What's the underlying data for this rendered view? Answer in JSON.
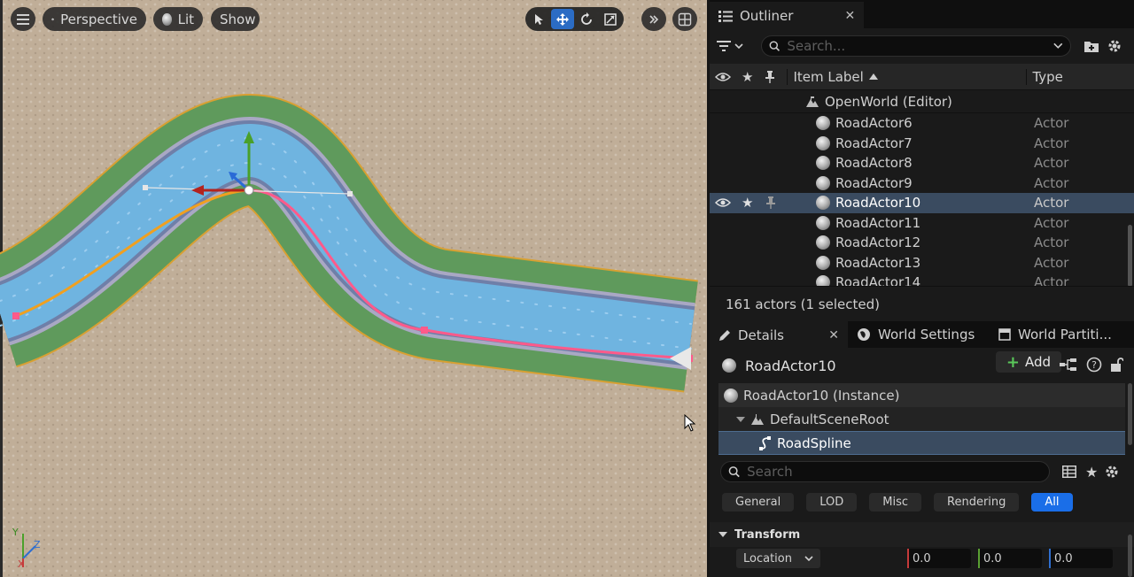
{
  "viewport": {
    "menu_icon": "hamburger-icon",
    "perspective_label": "Perspective",
    "lit_label": "Lit",
    "show_label": "Show",
    "tools": [
      "select-icon",
      "move-icon",
      "rotate-icon",
      "scale-icon"
    ],
    "active_tool": "move",
    "axis": {
      "x": "X",
      "y": "Y",
      "z": "Z"
    }
  },
  "outliner": {
    "tab_label": "Outliner",
    "search_placeholder": "Search...",
    "col_label": "Item Label",
    "col_type": "Type",
    "world_label": "OpenWorld (Editor)",
    "rows": [
      {
        "label": "RoadActor6",
        "type": "Actor",
        "selected": false
      },
      {
        "label": "RoadActor7",
        "type": "Actor",
        "selected": false
      },
      {
        "label": "RoadActor8",
        "type": "Actor",
        "selected": false
      },
      {
        "label": "RoadActor9",
        "type": "Actor",
        "selected": false
      },
      {
        "label": "RoadActor10",
        "type": "Actor",
        "selected": true
      },
      {
        "label": "RoadActor11",
        "type": "Actor",
        "selected": false
      },
      {
        "label": "RoadActor12",
        "type": "Actor",
        "selected": false
      },
      {
        "label": "RoadActor13",
        "type": "Actor",
        "selected": false
      },
      {
        "label": "RoadActor14",
        "type": "Actor",
        "selected": false
      }
    ],
    "status": "161 actors (1 selected)"
  },
  "details": {
    "tabs": [
      "Details",
      "World Settings",
      "World Partiti..."
    ],
    "actor_name": "RoadActor10",
    "add_label": "Add",
    "components": {
      "instance": "RoadActor10 (Instance)",
      "root": "DefaultSceneRoot",
      "spline": "RoadSpline"
    },
    "search_placeholder": "Search",
    "filters": [
      "General",
      "LOD",
      "Misc",
      "Rendering",
      "All"
    ],
    "active_filter": "All",
    "section": "Transform",
    "location_label": "Location",
    "location": {
      "x": "0.0",
      "y": "0.0",
      "z": "0.0"
    }
  },
  "colors": {
    "selection": "#3a4b60",
    "accent": "#1a6ee8",
    "road_shoulder": "#5f9a5c",
    "road_lane": "#6fb4e0",
    "spline_selected": "#f0a020",
    "spline_pink": "#ff5a8a"
  }
}
